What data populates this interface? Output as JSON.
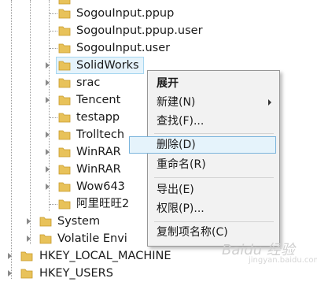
{
  "tree": {
    "items": [
      {
        "label": "SogouInput.ppup"
      },
      {
        "label": "SogouInput.ppup.user"
      },
      {
        "label": "SogouInput.user"
      },
      {
        "label": "SolidWorks"
      },
      {
        "label": "srac"
      },
      {
        "label": "Tencent"
      },
      {
        "label": "testapp"
      },
      {
        "label": "Trolltech"
      },
      {
        "label": "WinRAR"
      },
      {
        "label": "WinRAR"
      },
      {
        "label": "Wow643"
      },
      {
        "label": "阿里旺旺2"
      },
      {
        "label": "System"
      },
      {
        "label": "Volatile Envi"
      },
      {
        "label": "HKEY_LOCAL_MACHINE"
      },
      {
        "label": "HKEY_USERS"
      }
    ]
  },
  "context_menu": {
    "expand": "展开",
    "new": "新建(N)",
    "find": "查找(F)...",
    "delete": "删除(D)",
    "rename": "重命名(R)",
    "export": "导出(E)",
    "permissions": "权限(P)...",
    "copy_key_name": "复制项名称(C)"
  },
  "watermark": {
    "brand": "Baidu 经验",
    "url": "jingyan.baidu.com"
  },
  "colors": {
    "folder": "#e8c25a",
    "selection": "#e5f3fb",
    "selection_border": "#7ab4dc"
  }
}
